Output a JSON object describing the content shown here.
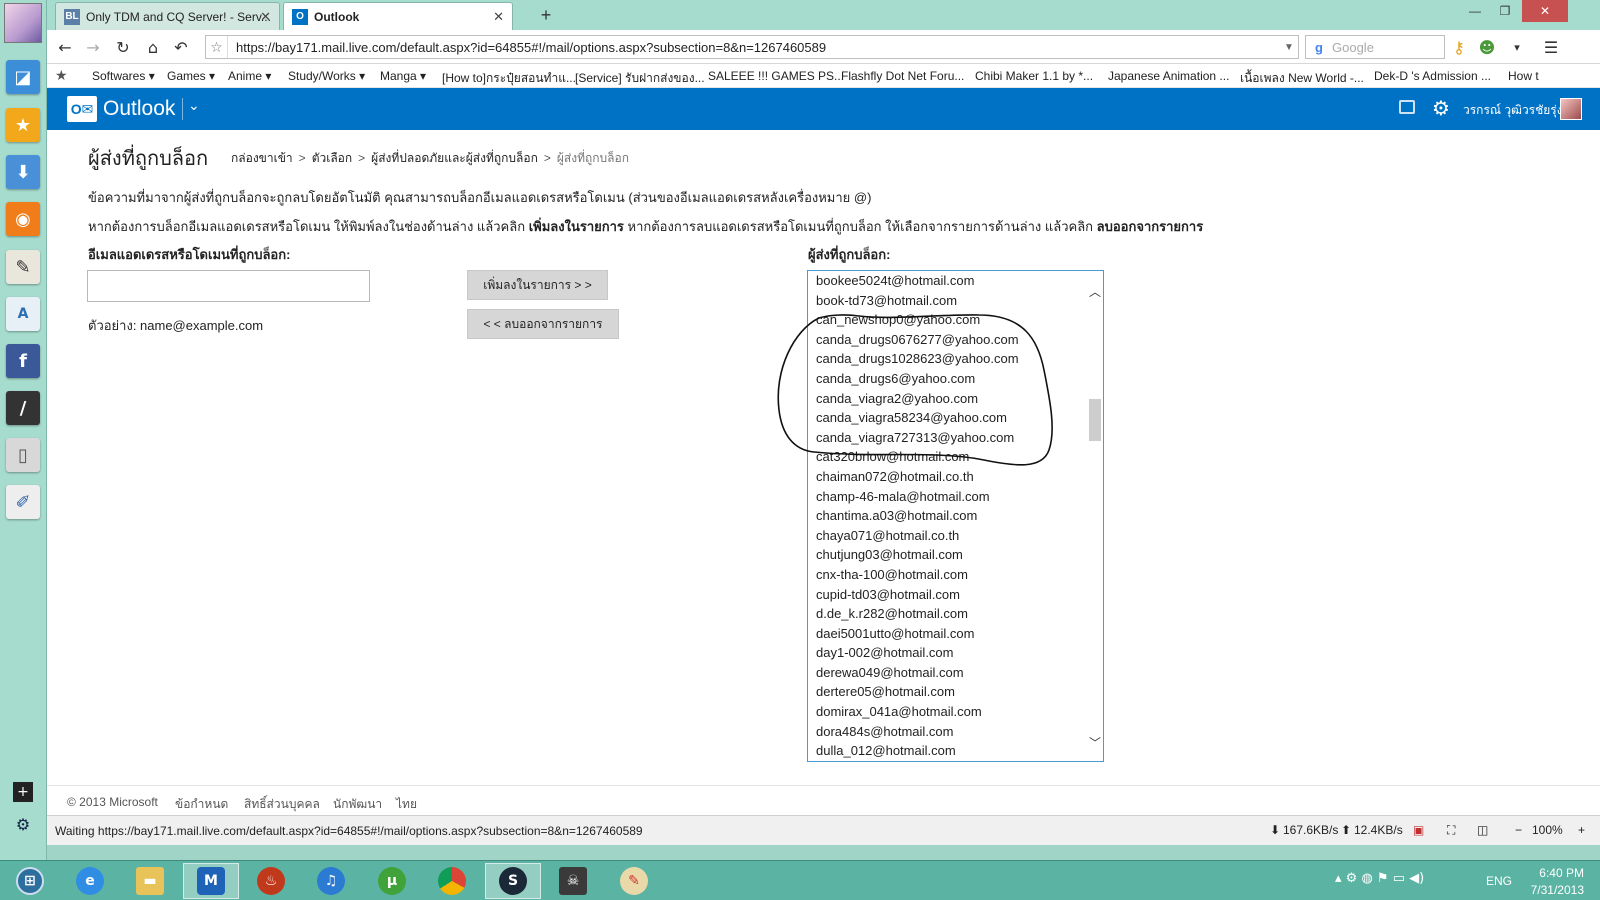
{
  "browser": {
    "tabs": [
      {
        "label": "Only TDM and CQ Server! - Serv..."
      },
      {
        "label": "Outlook"
      }
    ],
    "url": "https://bay171.mail.live.com/default.aspx?id=64855#!/mail/options.aspx?subsection=8&n=1267460589",
    "search_placeholder": "Google",
    "bookmarks": [
      "Softwares ▾",
      "Games ▾",
      "Anime ▾",
      "Study/Works ▾",
      "Manga ▾",
      "[How to]กระปุ๋ยสอนทำแ...",
      "[Service] รับฝากส่งของ...",
      "SALEEE !!! GAMES PS...",
      "Flashfly Dot Net Foru...",
      "Chibi Maker 1.1 by *...",
      "Japanese Animation ...",
      "เนื้อเพลง New World -...",
      "Dek-D 's Admission ...",
      "How t"
    ],
    "status_text": "Waiting https://bay171.mail.live.com/default.aspx?id=64855#!/mail/options.aspx?subsection=8&n=1267460589",
    "download_speed": "167.6KB/s",
    "upload_speed": "12.4KB/s",
    "zoom": "100%"
  },
  "outlook": {
    "app_title": "Outlook",
    "user_name": "วรกรณ์ วุฒิวรชัยรุ่ง",
    "brand_color": "#0072c6"
  },
  "page": {
    "title": "ผู้ส่งที่ถูกบล็อก",
    "breadcrumb": [
      "กล่องขาเข้า",
      "ตัวเลือก",
      "ผู้ส่งที่ปลอดภัยและผู้ส่งที่ถูกบล็อก",
      "ผู้ส่งที่ถูกบล็อก"
    ],
    "description1": "ข้อความที่มาจากผู้ส่งที่ถูกบล็อกจะถูกลบโดยอัตโนมัติ คุณสามารถบล็อกอีเมลแอดเดรสหรือโดเมน (ส่วนของอีเมลแอดเดรสหลังเครื่องหมาย @)",
    "description2_part1": "หากต้องการบล็อกอีเมลแอดเดรสหรือโดเมน ให้พิมพ์ลงในช่องด้านล่าง แล้วคลิก ",
    "description2_bold1": "เพิ่มลงในรายการ",
    "description2_part2": " หากต้องการลบแอดเดรสหรือโดเมนที่ถูกบล็อก ให้เลือกจากรายการด้านล่าง แล้วคลิก ",
    "description2_bold2": "ลบออกจากรายการ",
    "input_label": "อีเมลแอดเดรสหรือโดเมนที่ถูกบล็อก:",
    "input_value": "",
    "example_text": "ตัวอย่าง: name@example.com",
    "add_button": "เพิ่มลงในรายการ > >",
    "remove_button": "< < ลบออกจากรายการ",
    "list_label": "ผู้ส่งที่ถูกบล็อก:",
    "blocked_senders": [
      "bookee5024t@hotmail.com",
      "book-td73@hotmail.com",
      "can_newshop0@yahoo.com",
      "canda_drugs0676277@yahoo.com",
      "canda_drugs1028623@yahoo.com",
      "canda_drugs6@yahoo.com",
      "canda_viagra2@yahoo.com",
      "canda_viagra58234@yahoo.com",
      "canda_viagra727313@yahoo.com",
      "cat320brlow@hotmail.com",
      "chaiman072@hotmail.co.th",
      "champ-46-mala@hotmail.com",
      "chantima.a03@hotmail.com",
      "chaya071@hotmail.co.th",
      "chutjung03@hotmail.com",
      "cnx-tha-100@hotmail.com",
      "cupid-td03@hotmail.com",
      "d.de_k.r282@hotmail.com",
      "daei5001utto@hotmail.com",
      "day1-002@hotmail.com",
      "derewa049@hotmail.com",
      "dertere05@hotmail.com",
      "domirax_041a@hotmail.com",
      "dora484s@hotmail.com",
      "dulla_012@hotmail.com"
    ]
  },
  "footer": {
    "copyright": "© 2013 Microsoft",
    "links": [
      "ข้อกำหนด",
      "สิทธิ์ส่วนบุคคล",
      "นักพัฒนา",
      "ไทย"
    ]
  },
  "taskbar": {
    "language": "ENG",
    "time": "6:40 PM",
    "date": "7/31/2013"
  }
}
